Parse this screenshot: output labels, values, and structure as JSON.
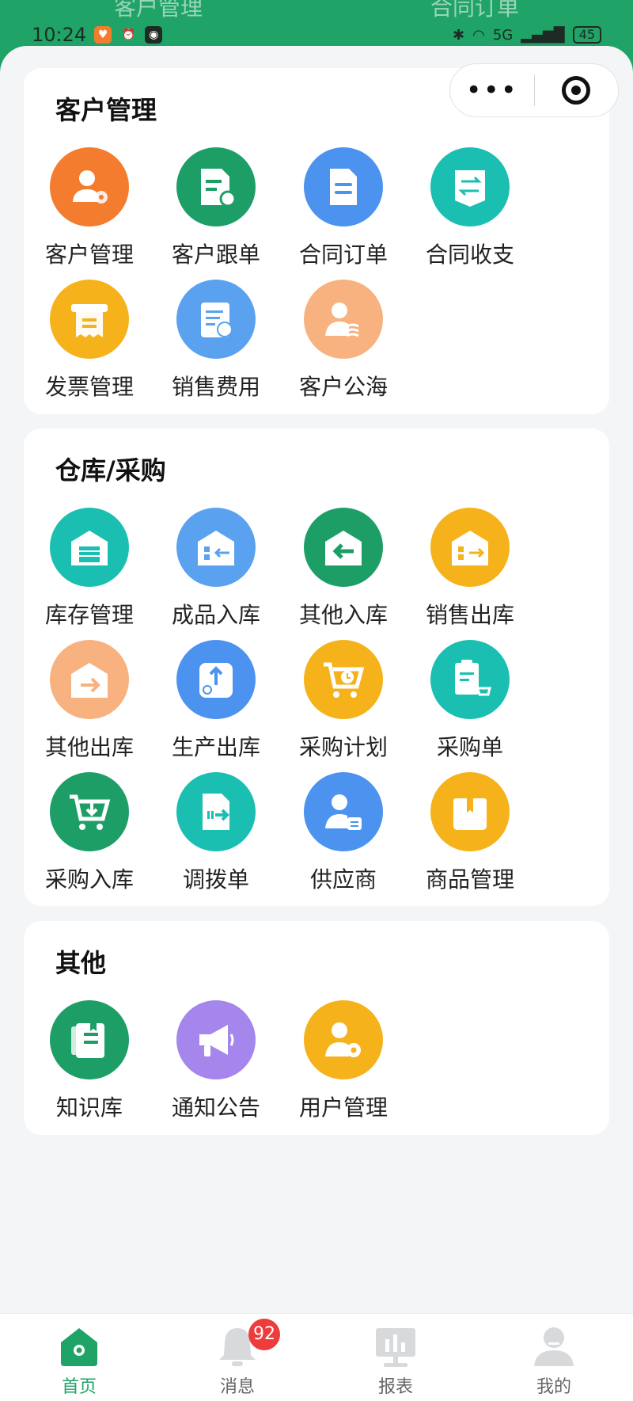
{
  "behind_tabs": [
    "客户管理",
    "合同订单"
  ],
  "status_bar": {
    "time": "10:24",
    "network": "5G",
    "battery": "45"
  },
  "capsule": {
    "more": "•••"
  },
  "sections": [
    {
      "title": "客户管理",
      "items": [
        {
          "label": "客户管理",
          "icon": "user-gear-icon",
          "color": "#f47c2e"
        },
        {
          "label": "客户跟单",
          "icon": "document-track-icon",
          "color": "#1e9e67"
        },
        {
          "label": "合同订单",
          "icon": "document-icon",
          "color": "#4b93ee"
        },
        {
          "label": "合同收支",
          "icon": "exchange-icon",
          "color": "#1bbfb2"
        },
        {
          "label": "发票管理",
          "icon": "invoice-icon",
          "color": "#f6b21a"
        },
        {
          "label": "销售费用",
          "icon": "expense-icon",
          "color": "#5aa2f0"
        },
        {
          "label": "客户公海",
          "icon": "user-wave-icon",
          "color": "#f7b27f"
        }
      ]
    },
    {
      "title": "仓库/采购",
      "items": [
        {
          "label": "库存管理",
          "icon": "warehouse-icon",
          "color": "#1bbfb2"
        },
        {
          "label": "成品入库",
          "icon": "inbound-icon",
          "color": "#5aa2f0"
        },
        {
          "label": "其他入库",
          "icon": "inbound-arrow-icon",
          "color": "#1e9e67"
        },
        {
          "label": "销售出库",
          "icon": "outbound-icon",
          "color": "#f6b21a"
        },
        {
          "label": "其他出库",
          "icon": "outbound-arrow-icon",
          "color": "#f7b27f"
        },
        {
          "label": "生产出库",
          "icon": "tray-upload-icon",
          "color": "#4b93ee"
        },
        {
          "label": "采购计划",
          "icon": "cart-clock-icon",
          "color": "#f6b21a"
        },
        {
          "label": "采购单",
          "icon": "clipboard-cart-icon",
          "color": "#1bbfb2"
        },
        {
          "label": "采购入库",
          "icon": "cart-download-icon",
          "color": "#1e9e67"
        },
        {
          "label": "调拨单",
          "icon": "transfer-doc-icon",
          "color": "#1bbfb2"
        },
        {
          "label": "供应商",
          "icon": "supplier-icon",
          "color": "#4b93ee"
        },
        {
          "label": "商品管理",
          "icon": "box-icon",
          "color": "#f6b21a"
        }
      ]
    },
    {
      "title": "其他",
      "items": [
        {
          "label": "知识库",
          "icon": "book-icon",
          "color": "#1e9e67"
        },
        {
          "label": "通知公告",
          "icon": "megaphone-icon",
          "color": "#a486ec"
        },
        {
          "label": "用户管理",
          "icon": "user-admin-icon",
          "color": "#f6b21a"
        }
      ]
    }
  ],
  "nav": [
    {
      "label": "首页",
      "icon": "home-icon",
      "active": true
    },
    {
      "label": "消息",
      "icon": "bell-icon",
      "badge": "92"
    },
    {
      "label": "报表",
      "icon": "report-icon"
    },
    {
      "label": "我的",
      "icon": "profile-icon"
    }
  ],
  "colors": {
    "brand": "#1fa366",
    "badge": "#ee3b3b"
  }
}
